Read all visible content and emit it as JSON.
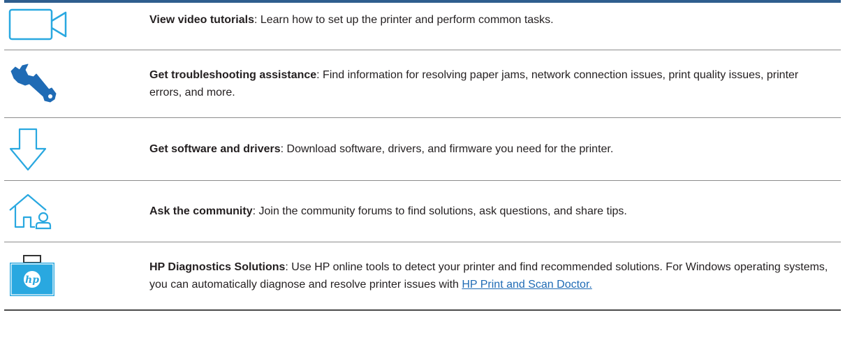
{
  "accent_color": "#29a8e0",
  "rule_color": "#2f5e8e",
  "rows": [
    {
      "icon": "video-camera-icon",
      "title": "View video tutorials",
      "description": ": Learn how to set up the printer and perform common tasks."
    },
    {
      "icon": "wrench-icon",
      "title": "Get troubleshooting assistance",
      "description": ": Find information for resolving paper jams, network connection issues, print quality issues, printer errors, and more."
    },
    {
      "icon": "download-arrow-icon",
      "title": "Get software and drivers",
      "description": ": Download software, drivers, and firmware you need for the printer."
    },
    {
      "icon": "community-home-icon",
      "title": "Ask the community",
      "description": ": Join the community forums to find solutions, ask questions, and share tips."
    },
    {
      "icon": "hp-briefcase-icon",
      "title": "HP Diagnostics Solutions",
      "description": ": Use HP online tools to detect your printer and find recommended solutions. For Windows operating systems, you can automatically diagnose and resolve printer issues with ",
      "link_text": "HP Print and Scan Doctor."
    }
  ]
}
